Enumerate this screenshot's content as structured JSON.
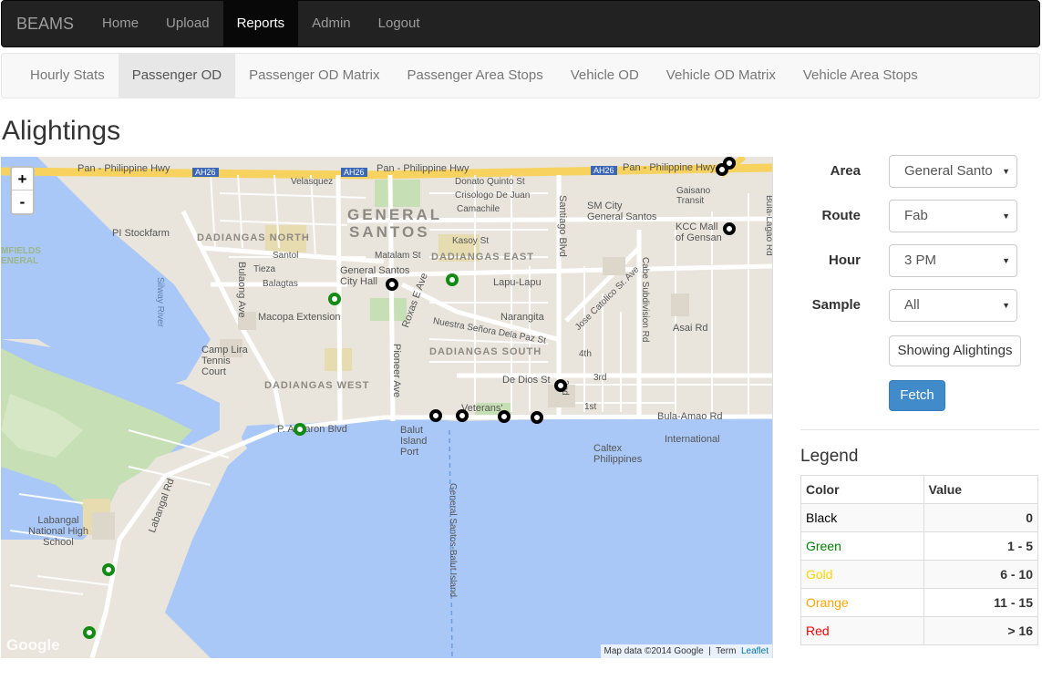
{
  "navbar": {
    "brand": "BEAMS",
    "items": [
      {
        "label": "Home"
      },
      {
        "label": "Upload"
      },
      {
        "label": "Reports"
      },
      {
        "label": "Admin"
      },
      {
        "label": "Logout"
      }
    ],
    "active": "Reports"
  },
  "subnav": {
    "items": [
      {
        "label": "Hourly Stats"
      },
      {
        "label": "Passenger OD"
      },
      {
        "label": "Passenger OD Matrix"
      },
      {
        "label": "Passenger Area Stops"
      },
      {
        "label": "Vehicle OD"
      },
      {
        "label": "Vehicle OD Matrix"
      },
      {
        "label": "Vehicle Area Stops"
      }
    ],
    "active": "Passenger OD"
  },
  "page": {
    "title": "Alightings"
  },
  "map": {
    "zoom_in": "+",
    "zoom_out": "-",
    "labels": {
      "hwy1": "Pan - Philippine Hwy",
      "hwy2": "Pan - Philippine Hwy",
      "hwy3": "Pan - Philippine Hwy",
      "ah26a": "AH26",
      "ah26b": "AH26",
      "ah26c": "AH26",
      "city1": "GENERAL",
      "city2": "SANTOS",
      "dadiangas_north": "DADIANGAS NORTH",
      "dadiangas_east": "DADIANGAS EAST",
      "dadiangas_south": "DADIANGAS SOUTH",
      "dadiangas_west": "DADIANGAS WEST",
      "pi_stockfarm": "PI Stockfarm",
      "camp_lira": "Camp Lira Tennis Court",
      "gs_city_hall": "General Santos City Hall",
      "macopa": "Macopa Extension",
      "sm_city": "SM City General Santos",
      "kcc": "KCC Mall of Gensan",
      "gaisano": "Gaisano Transit",
      "caltex": "Caltex Philippines",
      "balut_port": "Balut Island Port",
      "labangal_hs": "Labangal National High School",
      "bula_amao": "Bula-Amao Rd",
      "p_acharon": "P. Acharon Blvd",
      "pioneer": "Pioneer Ave",
      "roxas": "Roxas E Ave",
      "santiago": "Santiago Blvd",
      "bulaong": "Bulaong Ave",
      "labangal": "Labangal Rd",
      "channel": "General Santos-Balut Island",
      "silway": "Silway River",
      "lapu": "Lapu-Lapu",
      "narangita": "Narangita",
      "asai": "Asai Rd",
      "international": "International",
      "de_dios": "De Dios St",
      "veterans": "Veterans'",
      "nuestra": "Nuestra Señora Dela Paz St",
      "jose": "Jose Catolico Sr. Ave",
      "cabe": "Cabe Subdivision Rd",
      "bula_lagao": "Bula-Lagao Rd",
      "donato": "Donato Quinto St",
      "crisologo": "Crisologo De Juan",
      "camachile": "Camachile",
      "kasoy": "Kasoy St",
      "matalam": "Matalam St",
      "velasquez": "Velasquez",
      "santol": "Santol",
      "tieza": "Tieza",
      "balagtas": "Balagtas",
      "mafields": "MFIELDS ENERAL",
      "fourth": "4th",
      "third": "3rd",
      "second": "2nd",
      "first": "1st"
    },
    "attribution_text": "Map data ©2014 Google",
    "terms": "Term",
    "leaflet": "Leaflet",
    "google": "Google"
  },
  "form": {
    "area": {
      "label": "Area",
      "value": "General Santo"
    },
    "route": {
      "label": "Route",
      "value": "Fab"
    },
    "hour": {
      "label": "Hour",
      "value": "3 PM"
    },
    "sample": {
      "label": "Sample",
      "value": "All"
    },
    "toggle_label": "Showing Alightings",
    "fetch_label": "Fetch"
  },
  "legend": {
    "title": "Legend",
    "headers": [
      "Color",
      "Value"
    ],
    "rows": [
      {
        "color": "Black",
        "value": "0",
        "hex": "#000000"
      },
      {
        "color": "Green",
        "value": "1 - 5",
        "hex": "#008000"
      },
      {
        "color": "Gold",
        "value": "6 - 10",
        "hex": "#ffd700"
      },
      {
        "color": "Orange",
        "value": "11 - 15",
        "hex": "#ffa500"
      },
      {
        "color": "Red",
        "value": "> 16",
        "hex": "#ff0000"
      }
    ]
  }
}
